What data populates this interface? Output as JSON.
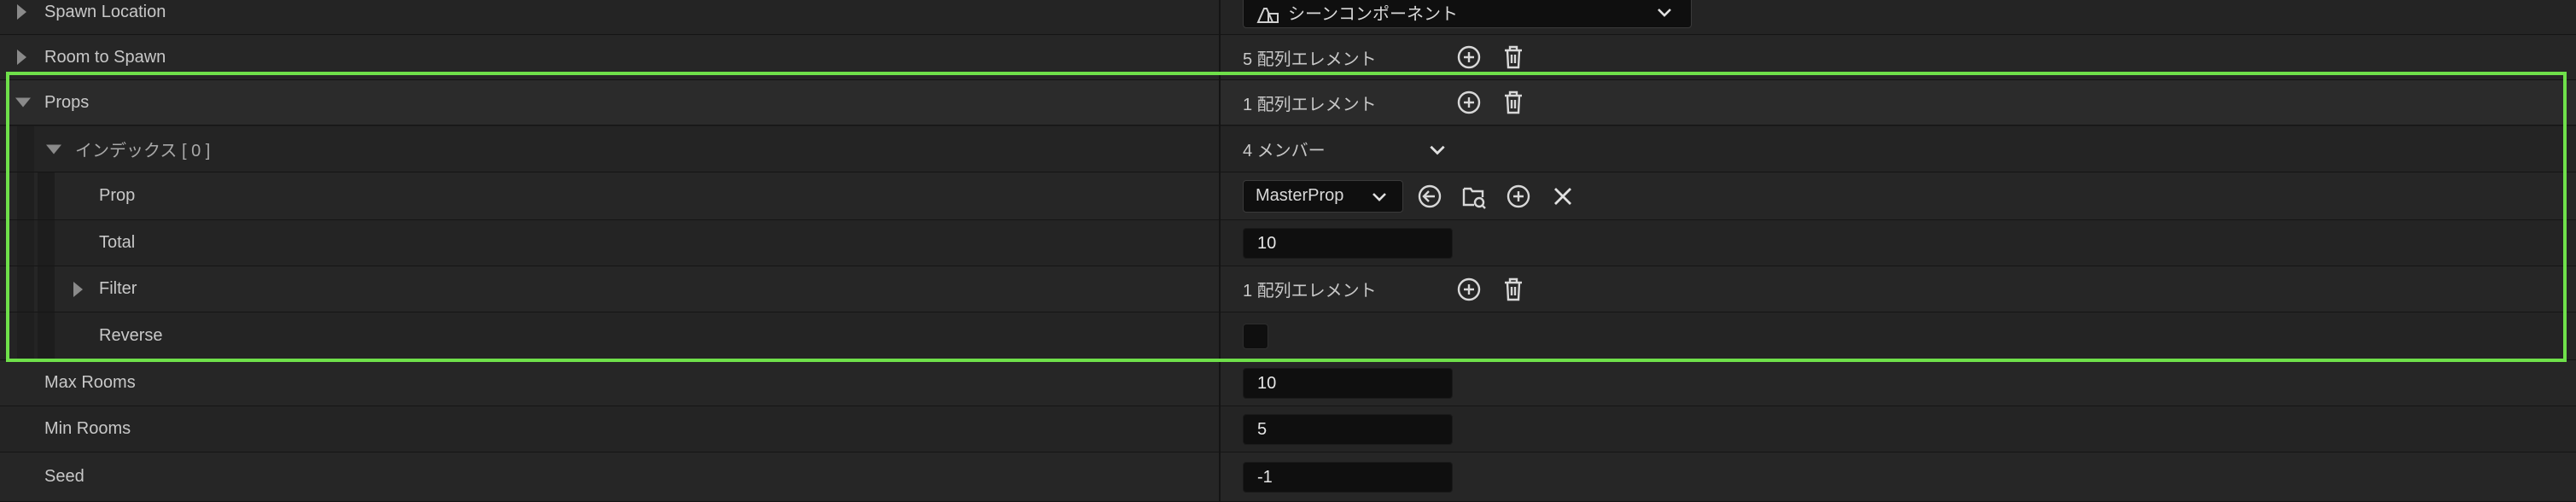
{
  "rows": {
    "spawn_location": {
      "label": "Spawn Location",
      "value": "シーンコンポーネント",
      "icon": "scene-component-icon"
    },
    "room_to_spawn": {
      "label": "Room to Spawn",
      "value": "5 配列エレメント"
    },
    "props": {
      "label": "Props",
      "value": "1 配列エレメント"
    },
    "index0": {
      "label": "インデックス [ 0 ]",
      "value": "4 メンバー"
    },
    "prop": {
      "label": "Prop",
      "value": "MasterProp"
    },
    "total": {
      "label": "Total",
      "value": "10"
    },
    "filter": {
      "label": "Filter",
      "value": "1 配列エレメント"
    },
    "reverse": {
      "label": "Reverse",
      "checked": false
    },
    "max_rooms": {
      "label": "Max Rooms",
      "value": "10"
    },
    "min_rooms": {
      "label": "Min Rooms",
      "value": "5"
    },
    "seed": {
      "label": "Seed",
      "value": "-1"
    }
  },
  "colors": {
    "highlight": "#6fe04a",
    "background": "#242424",
    "input_bg": "#0f0f0f",
    "text": "#c8c8c8"
  },
  "icons": {
    "add": "plus-circle-icon",
    "delete": "trash-icon",
    "browse_back": "back-arrow-icon",
    "browse_asset": "folder-search-icon",
    "clear": "close-icon",
    "expand": "chevron-down-icon"
  }
}
